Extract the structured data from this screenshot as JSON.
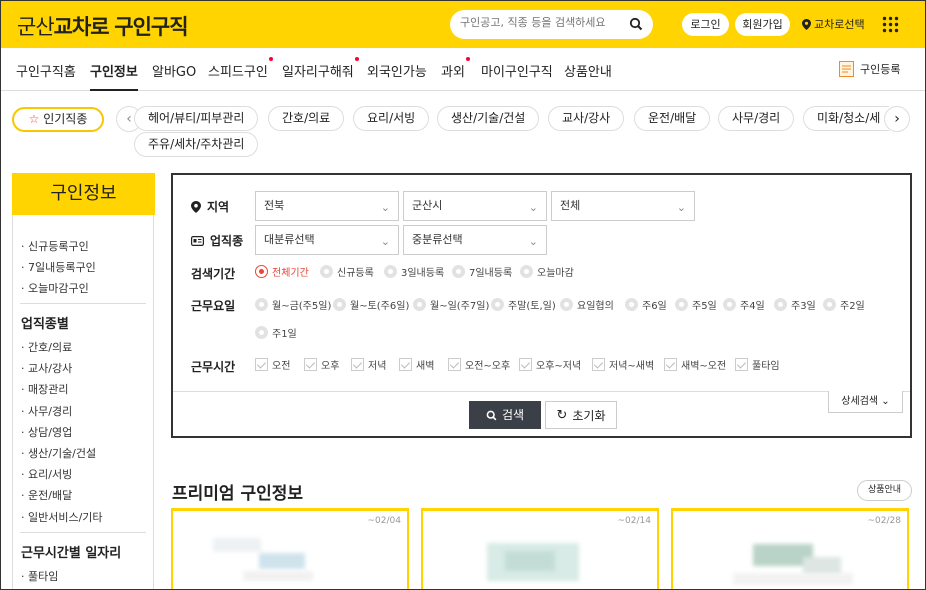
{
  "header": {
    "logo_prefix": "군산",
    "logo_brand": "교차로",
    "logo_suffix": "구인구직",
    "search_placeholder": "구인공고, 직종 등을 검색하세요",
    "login": "로그인",
    "signup": "회원가입",
    "region": "교차로선택",
    "accent_color": "#ffd400"
  },
  "nav": {
    "items": [
      "구인구직홈",
      "구인정보",
      "알바GO",
      "스피드구인",
      "일자리구해줘",
      "외국인가능",
      "과외",
      "마이구인구직",
      "상품안내"
    ],
    "active_index": 1,
    "register": "구인등록"
  },
  "categories": {
    "popular_label": "인기직종",
    "row1": [
      "헤어/뷰티/피부관리",
      "간호/의료",
      "요리/서빙",
      "생산/기술/건설",
      "교사/강사",
      "운전/배달",
      "사무/경리",
      "미화/청소/세"
    ],
    "row2": [
      "주유/세차/주차관리"
    ]
  },
  "sidebar": {
    "title": "구인정보",
    "quick": [
      "신규등록구인",
      "7일내등록구인",
      "오늘마감구인"
    ],
    "section1_title": "업직종별",
    "section1": [
      "간호/의료",
      "교사/강사",
      "매장관리",
      "사무/경리",
      "상담/영업",
      "생산/기술/건설",
      "요리/서빙",
      "운전/배달",
      "일반서비스/기타"
    ],
    "section2_title": "근무시간별 일자리",
    "section2": [
      "풀타임"
    ]
  },
  "filters": {
    "region_label": "지역",
    "region_values": [
      "전북",
      "군산시",
      "전체"
    ],
    "job_label": "업직종",
    "job_values": [
      "대분류선택",
      "중분류선택"
    ],
    "period_label": "검색기간",
    "period_options": [
      "전체기간",
      "신규등록",
      "3일내등록",
      "7일내등록",
      "오늘마감"
    ],
    "period_selected": 0,
    "days_label": "근무요일",
    "days_options": [
      "월~금(주5일)",
      "월~토(주6일)",
      "월~일(주7일)",
      "주말(토,일)",
      "요일협의",
      "주6일",
      "주5일",
      "주4일",
      "주3일",
      "주2일",
      "주1일"
    ],
    "hours_label": "근무시간",
    "hours_options": [
      "오전",
      "오후",
      "저녁",
      "새벽",
      "오전~오후",
      "오후~저녁",
      "저녁~새벽",
      "새벽~오전",
      "풀타임"
    ],
    "search_button": "검색",
    "reset_button": "초기화",
    "detail_button": "상세검색"
  },
  "premium": {
    "title": "프리미엄 구인정보",
    "product_info": "상품안내",
    "cards": [
      {
        "date": "~02/04"
      },
      {
        "date": "~02/14"
      },
      {
        "date": "~02/28"
      }
    ]
  }
}
